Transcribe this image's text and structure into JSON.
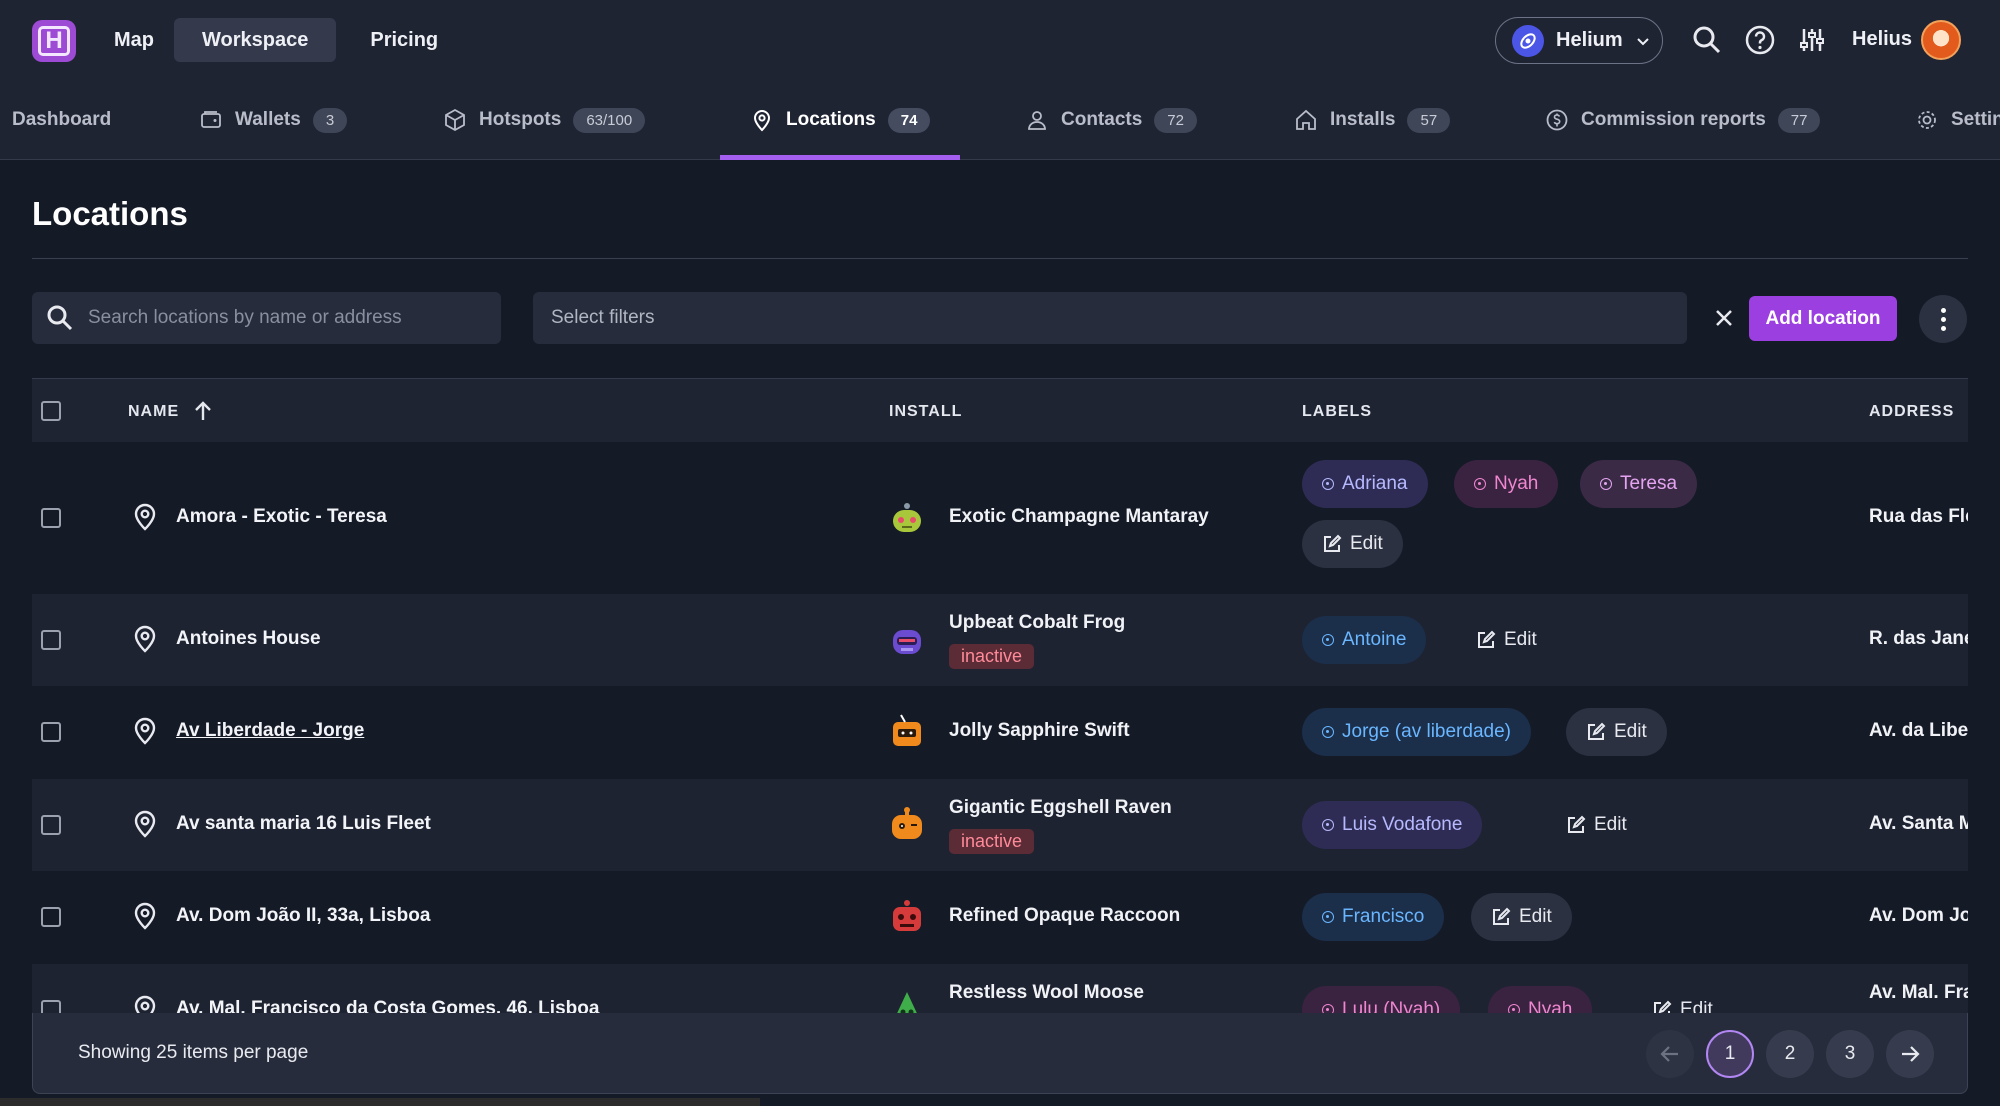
{
  "header": {
    "logo_letter": "H",
    "nav": [
      {
        "label": "Map",
        "active": false
      },
      {
        "label": "Workspace",
        "active": true
      },
      {
        "label": "Pricing",
        "active": false
      }
    ],
    "network": "Helium",
    "user_name": "Helius"
  },
  "tabs": [
    {
      "label": "Dashboard",
      "badge": "",
      "icon": "none"
    },
    {
      "label": "Wallets",
      "badge": "3",
      "icon": "wallet-icon"
    },
    {
      "label": "Hotspots",
      "badge": "63/100",
      "icon": "cube-icon"
    },
    {
      "label": "Locations",
      "badge": "74",
      "icon": "map-pin-icon",
      "active": true
    },
    {
      "label": "Contacts",
      "badge": "72",
      "icon": "user-icon"
    },
    {
      "label": "Installs",
      "badge": "57",
      "icon": "home-icon"
    },
    {
      "label": "Commission reports",
      "badge": "77",
      "icon": "dollar-circle-icon"
    },
    {
      "label": "Settin",
      "badge": "",
      "icon": "gear-icon"
    }
  ],
  "page": {
    "title": "Locations",
    "search_placeholder": "Search locations by name or address",
    "filters_placeholder": "Select filters",
    "add_button": "Add location"
  },
  "table": {
    "columns": {
      "name": "NAME",
      "install": "INSTALL",
      "labels": "LABELS",
      "address": "ADDRESS"
    },
    "rows": [
      {
        "name": "Amora - Exotic - Teresa",
        "install": "Exotic Champagne Mantaray",
        "status": "",
        "labels": [
          {
            "text": "Adriana",
            "color": "purple"
          },
          {
            "text": "Nyah",
            "color": "magenta"
          },
          {
            "text": "Teresa",
            "color": "pink"
          }
        ],
        "edit": "Edit",
        "address": "Rua das Flo"
      },
      {
        "name": "Antoines House",
        "install": "Upbeat Cobalt Frog",
        "status": "inactive",
        "labels": [
          {
            "text": "Antoine",
            "color": "blue"
          }
        ],
        "edit": "Edit",
        "address": "R. das Jane"
      },
      {
        "name": "Av Liberdade - Jorge",
        "install": "Jolly Sapphire Swift",
        "status": "",
        "labels": [
          {
            "text": "Jorge (av liberdade)",
            "color": "blue"
          }
        ],
        "edit": "Edit",
        "address": "Av. da Liber"
      },
      {
        "name": "Av santa maria 16 Luis Fleet",
        "install": "Gigantic Eggshell Raven",
        "status": "inactive",
        "labels": [
          {
            "text": "Luis Vodafone",
            "color": "purple"
          }
        ],
        "edit": "Edit",
        "address": "Av. Santa M"
      },
      {
        "name": "Av. Dom João II, 33a, Lisboa",
        "install": "Refined Opaque Raccoon",
        "status": "",
        "labels": [
          {
            "text": "Francisco",
            "color": "blue"
          }
        ],
        "edit": "Edit",
        "address": "Av. Dom Jo"
      },
      {
        "name": "Av. Mal. Francisco da Costa Gomes, 46, Lisboa",
        "install": "Restless Wool Moose",
        "status": "",
        "labels": [
          {
            "text": "Lulu (Nyah)",
            "color": "magenta"
          },
          {
            "text": "Nyah",
            "color": "magenta"
          }
        ],
        "edit": "Edit",
        "address": "Av. Mal. Fra"
      }
    ]
  },
  "footer": {
    "text": "Showing 25 items per page",
    "pages": [
      "1",
      "2",
      "3"
    ],
    "current_page": "1"
  },
  "colors": {
    "accent": "#9b3fe0",
    "background": "#151a27",
    "inactive": "#ff8a98"
  }
}
